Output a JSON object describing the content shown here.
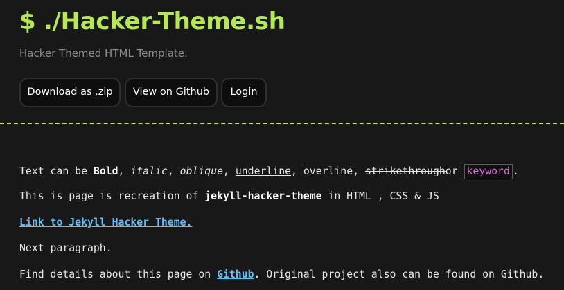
{
  "header": {
    "title": "$ ./Hacker-Theme.sh",
    "tagline": "Hacker Themed HTML Template.",
    "buttons": {
      "download": "Download as .zip",
      "github": "View on Github",
      "login": "Login"
    }
  },
  "content": {
    "line1": {
      "prefix": "Text can be ",
      "bold": "Bold",
      "sep1": ", ",
      "italic": "italic",
      "sep2": ", ",
      "oblique": "oblique",
      "sep3": ", ",
      "underline": "underline",
      "sep4": ", ",
      "overline": "overline",
      "sep5": ", ",
      "strike": "strikethrough",
      "or": "or ",
      "keyword": "keyword",
      "end": "."
    },
    "line2": {
      "prefix": "This is page is recreation of ",
      "bold": "jekyll-hacker-theme",
      "suffix": " in HTML , CSS & JS"
    },
    "line3": {
      "link": "Link to Jekyll Hacker Theme."
    },
    "line4": {
      "text": "Next paragraph."
    },
    "line5": {
      "prefix": "Find details about this page on ",
      "link": "Github",
      "suffix": ". Original project also can be found on Github."
    }
  },
  "colors": {
    "background": "#181818",
    "accent": "#b5e853",
    "link": "#63c0f5",
    "keyword": "#d76ad8",
    "tagline": "#8b8b8b"
  }
}
